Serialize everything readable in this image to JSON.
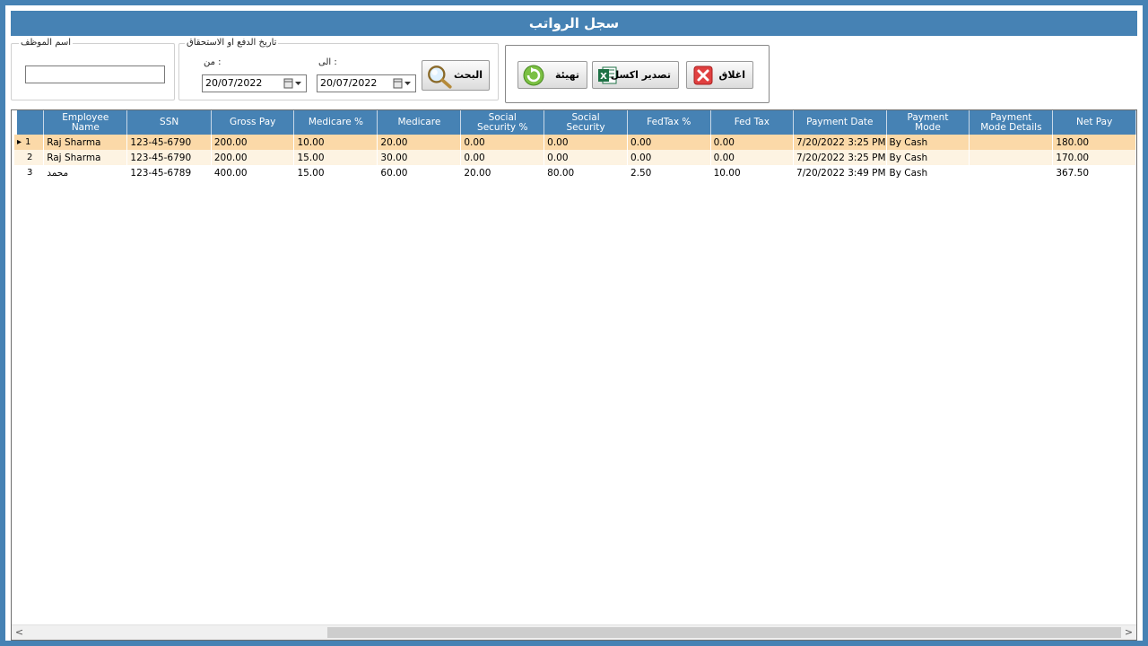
{
  "window": {
    "title": "سجل الرواتب"
  },
  "filters": {
    "employee_name_legend": "اسم الموظف",
    "employee_name_value": "",
    "date_legend": "تاريخ الدفع او الاستحقاق",
    "from_label": ": من",
    "to_label": ": الى",
    "from_date": "20/07/2022",
    "to_date": "20/07/2022",
    "search_label": "البحث"
  },
  "actions": {
    "reset_label": "تهيئة",
    "export_label": "تصدير اكسل",
    "close_label": "اغلاق"
  },
  "grid": {
    "columns": [
      "Employee\nName",
      "SSN",
      "Gross Pay",
      "Medicare %",
      "Medicare",
      "Social\nSecurity %",
      "Social\nSecurity",
      "FedTax %",
      "Fed Tax",
      "Payment Date",
      "Payment\nMode",
      "Payment\nMode Details",
      "Net Pay"
    ],
    "rows": [
      {
        "num": "1",
        "cells": [
          "Raj Sharma",
          "123-45-6790",
          "200.00",
          "10.00",
          "20.00",
          "0.00",
          "0.00",
          "0.00",
          "0.00",
          "7/20/2022 3:25 PM",
          "By Cash",
          "",
          "180.00"
        ]
      },
      {
        "num": "2",
        "cells": [
          "Raj Sharma",
          "123-45-6790",
          "200.00",
          "15.00",
          "30.00",
          "0.00",
          "0.00",
          "0.00",
          "0.00",
          "7/20/2022 3:25 PM",
          "By Cash",
          "",
          "170.00"
        ]
      },
      {
        "num": "3",
        "cells": [
          "محمد",
          "123-45-6789",
          "400.00",
          "15.00",
          "60.00",
          "20.00",
          "80.00",
          "2.50",
          "10.00",
          "7/20/2022 3:49 PM",
          "By Cash",
          "",
          "367.50"
        ]
      }
    ],
    "current_row_marker": "▸"
  },
  "colors": {
    "accent": "#4682b4",
    "selected_row": "#fbd9a8",
    "alt_row": "#fdf3e2"
  }
}
